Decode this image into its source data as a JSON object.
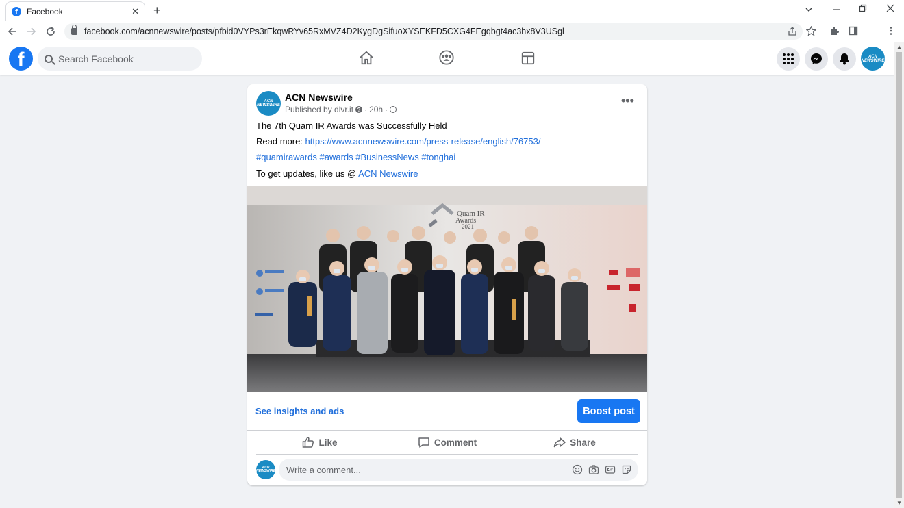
{
  "browser": {
    "tab_title": "Facebook",
    "tab_favicon": "f",
    "close_tab": "✕",
    "new_tab": "+",
    "url": "facebook.com/acnnewswire/posts/pfbid0VYPs3rEkqwRYv65RxMVZ4D2KygDgSifuoXYSEKFD5CXG4FEgqbgt4ac3hx8V3USgl"
  },
  "header": {
    "logo": "f",
    "search_placeholder": "Search Facebook",
    "avatar_text": "ACN NEWSWIRE"
  },
  "post": {
    "author": "ACN Newswire",
    "avatar_text": "ACN NEWSWIRE",
    "published_by": "Published by dlvr.it",
    "time": "20h",
    "lines": {
      "title": "The 7th Quam IR Awards was Successfully Held",
      "read_more_label": "Read more: ",
      "read_more_url": "https://www.acnnewswire.com/press-release/english/76753/",
      "hashtags": "#quamirawards #awards #BusinessNews #tonghai",
      "updates_label": "To get updates, like us @ ",
      "updates_link": "ACN Newswire"
    },
    "photo_backdrop": {
      "brand": "Quam IR",
      "subtitle": "Awards",
      "year": "2021"
    },
    "insights_link": "See insights and ads",
    "boost_label": "Boost post",
    "actions": {
      "like": "Like",
      "comment": "Comment",
      "share": "Share"
    },
    "comment_placeholder": "Write a comment..."
  },
  "colors": {
    "facebook_blue": "#1877f2",
    "link_blue": "#216fdb",
    "page_bg": "#f0f2f5"
  }
}
